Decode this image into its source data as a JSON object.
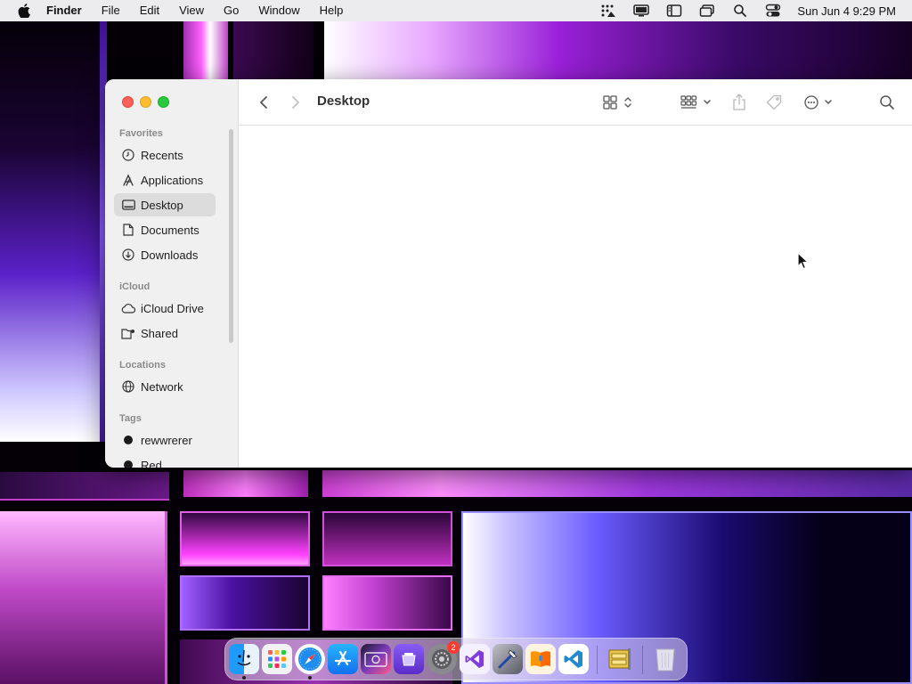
{
  "menubar": {
    "app_name": "Finder",
    "items": [
      "File",
      "Edit",
      "View",
      "Go",
      "Window",
      "Help"
    ],
    "clock": "Sun Jun 4  9:29 PM"
  },
  "window": {
    "title": "Desktop",
    "sidebar": {
      "favorites_title": "Favorites",
      "favorites": [
        {
          "label": "Recents",
          "icon": "clock-icon"
        },
        {
          "label": "Applications",
          "icon": "applications-icon"
        },
        {
          "label": "Desktop",
          "icon": "desktop-icon",
          "selected": true
        },
        {
          "label": "Documents",
          "icon": "document-icon"
        },
        {
          "label": "Downloads",
          "icon": "download-icon"
        }
      ],
      "icloud_title": "iCloud",
      "icloud": [
        {
          "label": "iCloud Drive",
          "icon": "cloud-icon"
        },
        {
          "label": "Shared",
          "icon": "shared-folder-icon"
        }
      ],
      "locations_title": "Locations",
      "locations": [
        {
          "label": "Network",
          "icon": "globe-icon"
        }
      ],
      "tags_title": "Tags",
      "tags": [
        {
          "label": "rewwrerer",
          "color": "#1a1a1a"
        },
        {
          "label": "Red",
          "color": "#1a1a1a"
        }
      ]
    }
  },
  "dock": {
    "apps": [
      "Finder",
      "Launchpad",
      "Safari",
      "App Store",
      "Photo Booth",
      "Podcasts",
      "System Settings",
      "Visual Studio",
      "Xcode Tools",
      "Books",
      "Visual Studio Code",
      "Archive Utility",
      "Trash"
    ],
    "settings_badge": "2"
  },
  "colors": {
    "close": "#fe5f57",
    "minimize": "#febc2e",
    "maximize": "#28c840",
    "selection": "#dcdcdd"
  }
}
